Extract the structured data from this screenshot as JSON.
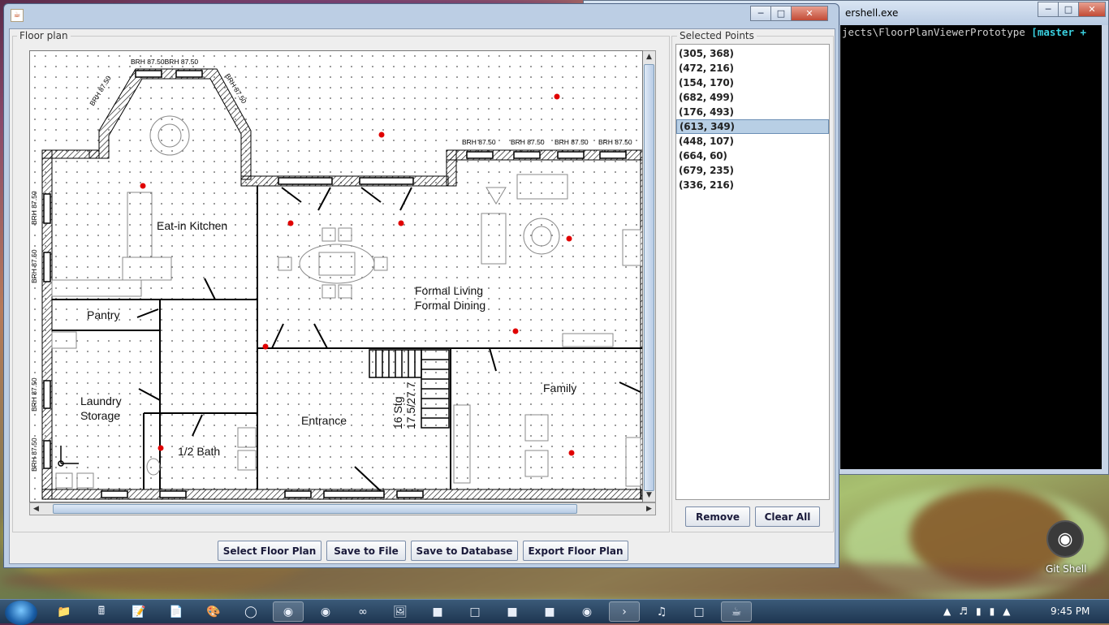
{
  "console": {
    "title": "ershell.exe",
    "prompt_text": "jects\\FloorPlanViewerPrototype ",
    "branch_text": "[master +"
  },
  "window": {
    "caption_buttons": [
      "minimize",
      "maximize",
      "close"
    ]
  },
  "floor_plan": {
    "group_label": "Floor plan",
    "rooms": [
      "Eat-in Kitchen",
      "Pantry",
      "Laundry",
      "Storage",
      "1/2 Bath",
      "Entrance",
      "Formal Living",
      "Formal Dining",
      "Family"
    ],
    "stairs_label_1": "16 Stg",
    "stairs_label_2": "17.5/27.7",
    "window_tag": "BRH 87.50",
    "top_window_tags": "BRH 87.50BRH 87.50",
    "icon_colors": {
      "points": "#e00000",
      "walls": "#000000"
    }
  },
  "selected_points": {
    "label": "Selected Points",
    "items": [
      "(305, 368)",
      "(472, 216)",
      "(154, 170)",
      "(682, 499)",
      "(176, 493)",
      "(613, 349)",
      "(448, 107)",
      "(664, 60)",
      "(679, 235)",
      "(336, 216)"
    ],
    "selected_index": 5
  },
  "buttons": {
    "remove": "Remove",
    "clear_all": "Clear All",
    "select_floor_plan": "Select Floor Plan",
    "save_to_file": "Save to File",
    "save_to_database": "Save to Database",
    "export_floor_plan": "Export Floor Plan"
  },
  "desktop": {
    "git_shell_label": "Git Shell"
  },
  "taskbar": {
    "time": "9:45 PM",
    "icons": [
      "folder-icon",
      "calculator-icon",
      "sticky-notes-icon",
      "notepad-icon",
      "paint-icon",
      "opera-icon",
      "chrome-icon",
      "firefox-icon",
      "link-icon",
      "gallery-icon",
      "app-icon",
      "virtualbox-icon",
      "network-icon",
      "scanner-icon",
      "messenger-icon",
      "powershell-icon",
      "itunes-icon",
      "virtualbox2-icon",
      "java-icon"
    ]
  }
}
